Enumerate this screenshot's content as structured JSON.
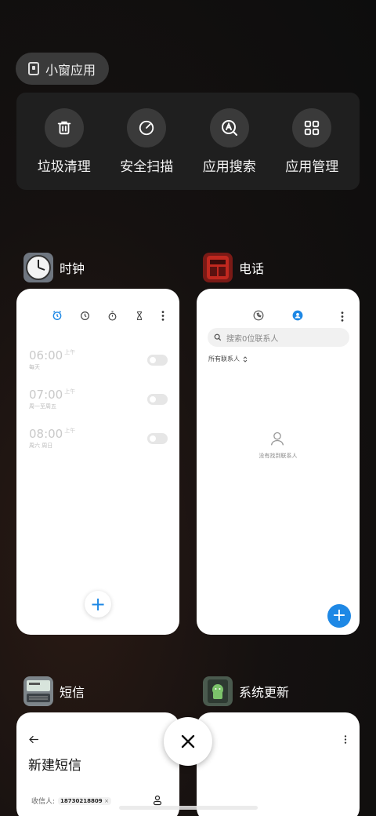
{
  "floating_window": {
    "label": "小窗应用"
  },
  "tools": [
    {
      "label": "垃圾清理",
      "icon": "trash-icon"
    },
    {
      "label": "安全扫描",
      "icon": "scan-icon"
    },
    {
      "label": "应用搜索",
      "icon": "search-app-icon"
    },
    {
      "label": "应用管理",
      "icon": "grid-icon"
    }
  ],
  "clock": {
    "app_name": "时钟",
    "alarms": [
      {
        "time": "06:00",
        "ampm": "上午",
        "repeat": "每天"
      },
      {
        "time": "07:00",
        "ampm": "上午",
        "repeat": "周一至周五"
      },
      {
        "time": "08:00",
        "ampm": "上午",
        "repeat": "周六 周日"
      }
    ],
    "add_label": "+"
  },
  "phone": {
    "app_name": "电话",
    "search_placeholder": "搜索0位联系人",
    "filter_label": "所有联系人",
    "empty_text": "没有找到联系人",
    "add_label": "+"
  },
  "sms": {
    "app_name": "短信",
    "title": "新建短信",
    "recipient_label": "收信人:",
    "recipient_chip": "18730218809"
  },
  "update": {
    "app_name": "系统更新"
  },
  "colors": {
    "accent": "#1e88e5"
  }
}
